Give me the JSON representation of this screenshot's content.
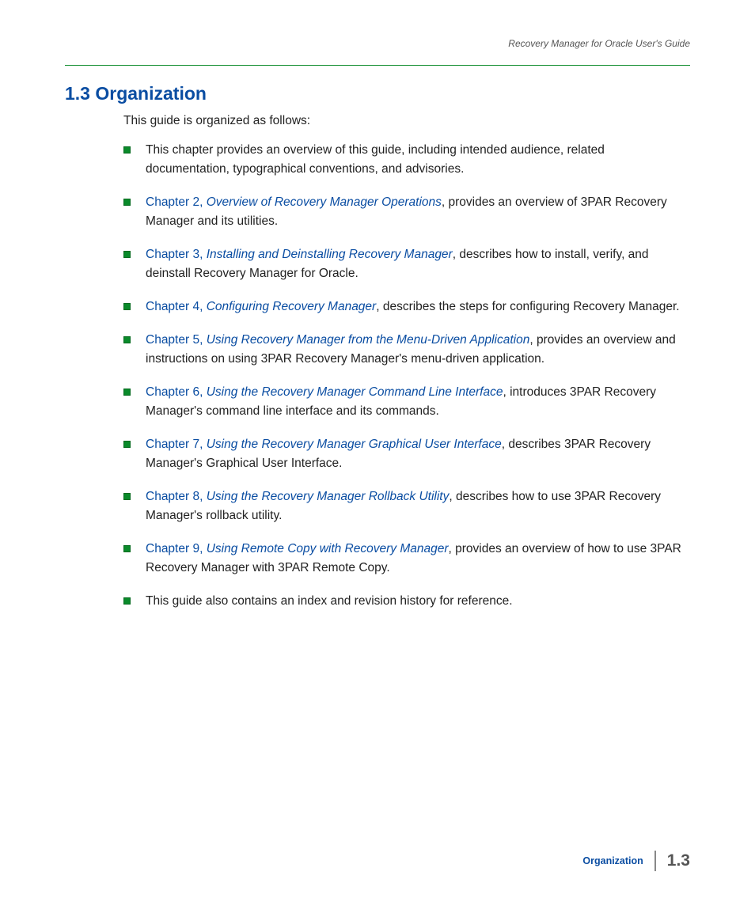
{
  "header": {
    "doc_title": "Recovery Manager for Oracle User's Guide"
  },
  "section": {
    "number": "1.3",
    "title": "Organization",
    "intro": "This guide is organized as follows:"
  },
  "items": [
    {
      "pre": "This chapter provides an overview of this guide, including intended audience, related documentation, typographical conventions, and advisories.",
      "link_chapter": "",
      "link_title": "",
      "post": ""
    },
    {
      "pre": "",
      "link_chapter": "Chapter 2, ",
      "link_title": "Overview of Recovery Manager Operations",
      "post": ", provides an overview of 3PAR Recovery Manager and its utilities."
    },
    {
      "pre": "",
      "link_chapter": "Chapter 3, ",
      "link_title": "Installing and Deinstalling Recovery Manager",
      "post": ", describes how to install, verify, and deinstall Recovery Manager for Oracle."
    },
    {
      "pre": "",
      "link_chapter": "Chapter 4, ",
      "link_title": "Configuring Recovery Manager",
      "post": ", describes the steps for configuring Recovery Manager."
    },
    {
      "pre": "",
      "link_chapter": "Chapter 5, ",
      "link_title": "Using Recovery Manager from the Menu-Driven Application",
      "post": ", provides an overview and instructions on using 3PAR Recovery Manager's menu-driven application."
    },
    {
      "pre": "",
      "link_chapter": "Chapter 6, ",
      "link_title": "Using the Recovery Manager Command Line Interface",
      "post": ", introduces 3PAR Recovery Manager's command line interface and its commands."
    },
    {
      "pre": "",
      "link_chapter": "Chapter 7, ",
      "link_title": "Using the Recovery Manager Graphical User Interface",
      "post": ", describes 3PAR Recovery Manager's Graphical User Interface."
    },
    {
      "pre": "",
      "link_chapter": "Chapter 8, ",
      "link_title": "Using the Recovery Manager Rollback Utility",
      "post": ", describes how to use 3PAR Recovery Manager's rollback utility."
    },
    {
      "pre": "",
      "link_chapter": "Chapter 9, ",
      "link_title": "Using Remote Copy with Recovery Manager",
      "post": ", provides an overview of how to use 3PAR Recovery Manager with 3PAR Remote Copy."
    },
    {
      "pre": "This guide also contains an index and revision history for reference.",
      "link_chapter": "",
      "link_title": "",
      "post": ""
    }
  ],
  "footer": {
    "label": "Organization",
    "page": "1.3"
  }
}
